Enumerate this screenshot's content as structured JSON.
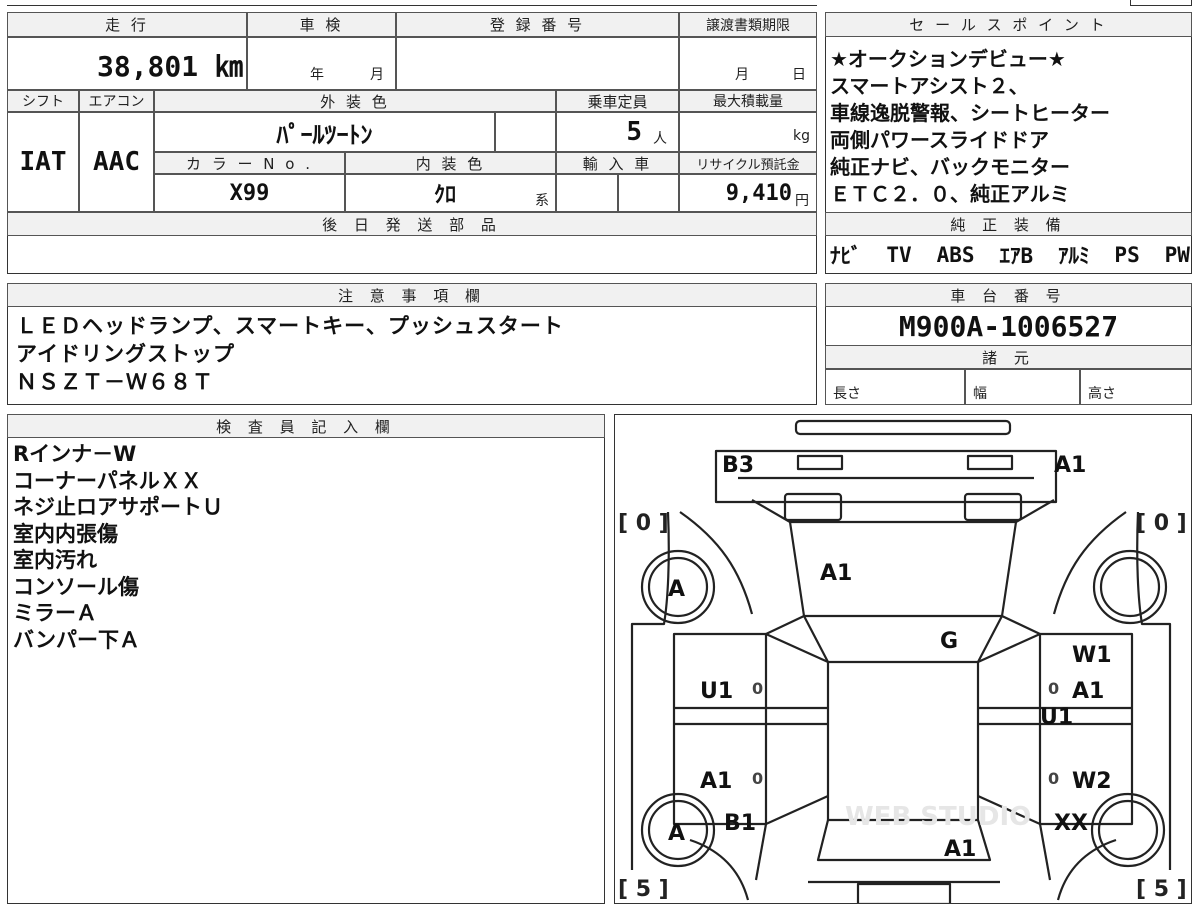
{
  "headers": {
    "mileage": "走 行",
    "inspection": "車 検",
    "registration": "登 録 番 号",
    "transfer_deadline": "譲渡書類期限",
    "sales_points": "セ ー ル ス ポ イ ン ト",
    "shift": "シフト",
    "aircon": "エアコン",
    "exterior_color": "外 装 色",
    "capacity": "乗車定員",
    "max_load": "最大積載量",
    "color_no": "カ ラ ー N o .",
    "interior_color": "内 装 色",
    "import": "輸 入 車",
    "recycle": "リサイクル預託金",
    "later_parts": "後 日 発 送 部 品",
    "factory_equipment": "純 正 装 備",
    "notes": "注 意 事 項 欄",
    "chassis_no": "車 台 番 号",
    "specs": "諸 元",
    "inspector": "検 査 員 記 入 欄"
  },
  "values": {
    "mileage": "38,801 ㎞",
    "insp_year": "年",
    "insp_month": "月",
    "deadline_month": "月",
    "deadline_day": "日",
    "shift": "IAT",
    "aircon": "AAC",
    "exterior_color": "ﾊﾟｰﾙﾂｰﾄﾝ",
    "capacity": "5",
    "capacity_unit": "人",
    "max_load_unit": "kg",
    "color_no": "X99",
    "interior_color": "ｸﾛ",
    "interior_suffix": "系",
    "recycle": "9,410",
    "recycle_unit": "円",
    "chassis_no": "M900A-1006527",
    "length": "長さ",
    "width": "幅",
    "height": "高さ"
  },
  "sales_points": [
    "★オークションデビュー★",
    "スマートアシスト２、",
    "車線逸脱警報、シートヒーター",
    "両側パワースライドドア",
    "純正ナビ、バックモニター",
    "ＥＴＣ２．０、純正アルミ"
  ],
  "equipment": [
    "ﾅﾋﾞ",
    "TV",
    "ABS",
    "ｴｱB",
    "ｱﾙﾐ",
    "PS",
    "PW"
  ],
  "notes": [
    "ＬＥＤヘッドランプ、スマートキー、プッシュスタート",
    "アイドリングストップ",
    "ＮＳＺＴ－Ｗ６８Ｔ"
  ],
  "inspector_notes": [
    "Rインナ－W",
    "コーナーパネルＸＸ",
    "ネジ止ロアサポートＵ",
    "室内内張傷",
    "室内汚れ",
    "コンソール傷",
    "ミラーＡ",
    "バンパー下Ａ"
  ],
  "diagram": {
    "tread_fl": "[ 0 ]",
    "tread_fr": "[ 0 ]",
    "tread_rl": "[ 5 ]",
    "tread_rr": "[ 5 ]",
    "marks": {
      "b3": "B3",
      "a1_top": "A1",
      "a1_hood": "A1",
      "tire_fl": "A",
      "g": "G",
      "w1": "W1",
      "u1_left": "U1",
      "a1_right": "A1",
      "u1_right": "U1",
      "a1_left": "A1",
      "w2": "W2",
      "tire_rl": "A",
      "b1": "B1",
      "xx": "XX",
      "a1_rear": "A1",
      "zero1": "0",
      "zero2": "0",
      "zero3": "0",
      "zero4": "0"
    },
    "watermark": "WEB STUDIO"
  }
}
